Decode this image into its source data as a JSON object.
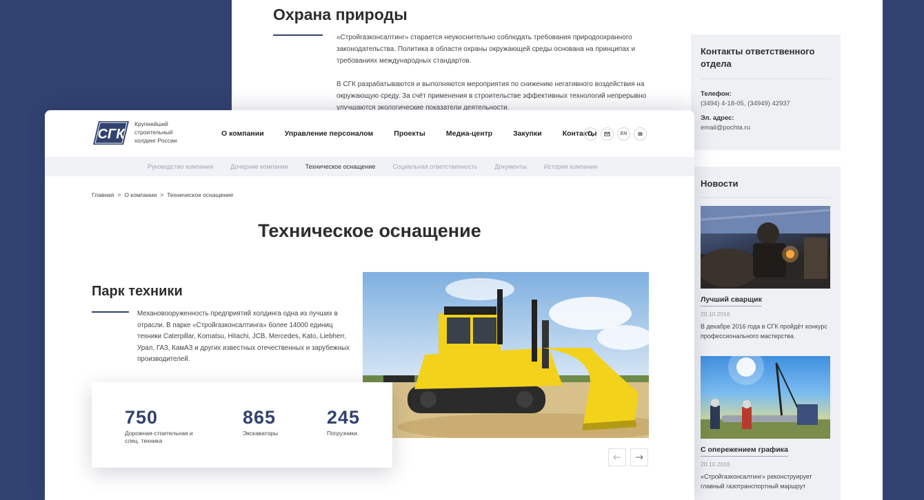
{
  "bg_page": {
    "title": "Охрана природы",
    "paragraph1": "«Стройгазконсалтинг» старается неукоснительно соблюдать требования природоохранного законодательства. Политика в области охраны окружающей среды основана на принципах и требованиях международных стандартов.",
    "paragraph2": "В СГК разрабатываются и выполняются мероприятия по снижению негативного воздействия на окружающую среду. За счёт применения в строительстве эффективных технологий непрерывно улучшаются экологические показатели деятельности.",
    "contacts": {
      "title": "Контакты ответственного отдела",
      "phone_label": "Телефон:",
      "phone_value": "(3494) 4-18-05, (34949) 42937",
      "email_label": "Эл. адрес:",
      "email_value": "email@pochta.ru"
    },
    "news": {
      "title": "Новости",
      "items": [
        {
          "title": "Лучший сварщик",
          "date": "20.10.2016",
          "text": "В декабре 2016 года в СГК пройдёт конкурс профессионального мастерства."
        },
        {
          "title": "С опережением графика",
          "date": "20.10.2016",
          "text": "«Стройгазконсалтинг» реконструирует главный газотранспортный маршрут"
        }
      ]
    }
  },
  "header": {
    "logo_text": "СГК",
    "tagline": "Крупнейший строительный холдинг России",
    "nav": [
      "О компании",
      "Управление персоналом",
      "Проекты",
      "Медиа-центр",
      "Закупки",
      "Контакты"
    ],
    "lang": "EN",
    "icons": [
      "search-icon",
      "mail-icon",
      "lang-switch",
      "menu-icon"
    ]
  },
  "sub_nav": {
    "items": [
      "Руководство компании",
      "Дочерние компании",
      "Техническое оснащение",
      "Социальная ответственность",
      "Документы",
      "История компании"
    ],
    "active_index": 2
  },
  "breadcrumb": {
    "items": [
      "Главная",
      "О компании",
      "Техническое оснащение"
    ],
    "separator": ">"
  },
  "page": {
    "title": "Техническое оснащение",
    "section_title": "Парк техники",
    "section_text": "Механовооруженность предприятий холдинга одна из лучших в отрасли. В парке «Стройгазконсалтинга» более 14000 единиц техники Caterpillar, Komatsu, Hitachi, JCB, Mercedes, Kato, Liebherr, Урал, ГАЗ, КамАЗ и других известных отечественных и зарубежных производителей."
  },
  "stats": [
    {
      "number": "750",
      "label": "Дорожная-стоительная и слец. техника"
    },
    {
      "number": "865",
      "label": "Экскаваторы"
    },
    {
      "number": "245",
      "label": "Погрузчики"
    }
  ],
  "colors": {
    "brand_blue": "#324271",
    "bulldozer_yellow": "#f2d21b",
    "sub_nav_bg": "#f1f2f6",
    "card_bg": "#eef0f4"
  }
}
